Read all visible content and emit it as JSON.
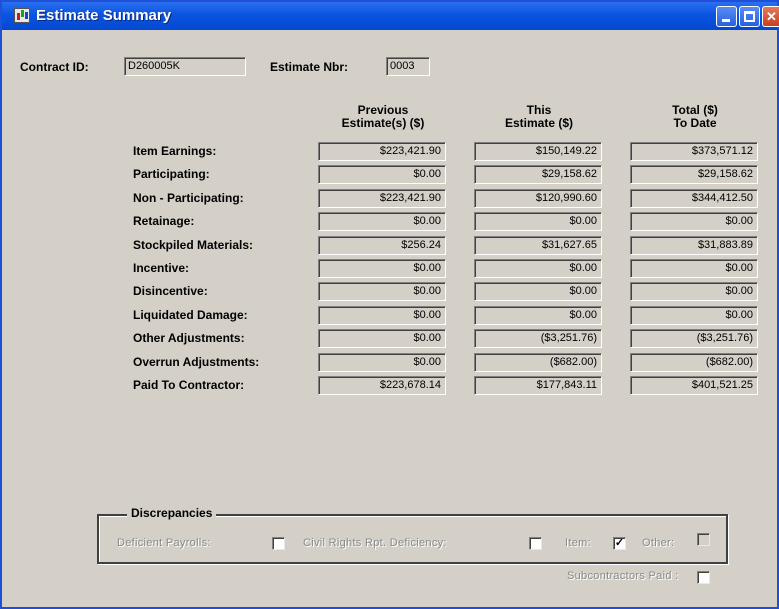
{
  "window": {
    "title": "Estimate Summary"
  },
  "header": {
    "contract_label": "Contract ID:",
    "contract_value": "D260005K",
    "estimate_label": "Estimate Nbr:",
    "estimate_value": "0003"
  },
  "columns": {
    "previous": {
      "line1": "Previous",
      "line2": "Estimate(s) ($)"
    },
    "this": {
      "line1": "This",
      "line2": "Estimate ($)"
    },
    "total": {
      "line1": "Total ($)",
      "line2": "To Date"
    }
  },
  "rows": [
    {
      "label": "Item Earnings:",
      "previous": "$223,421.90",
      "this": "$150,149.22",
      "total": "$373,571.12"
    },
    {
      "label": "Participating:",
      "previous": "$0.00",
      "this": "$29,158.62",
      "total": "$29,158.62"
    },
    {
      "label": "Non - Participating:",
      "previous": "$223,421.90",
      "this": "$120,990.60",
      "total": "$344,412.50"
    },
    {
      "label": "Retainage:",
      "previous": "$0.00",
      "this": "$0.00",
      "total": "$0.00"
    },
    {
      "label": "Stockpiled Materials:",
      "previous": "$256.24",
      "this": "$31,627.65",
      "total": "$31,883.89"
    },
    {
      "label": "Incentive:",
      "previous": "$0.00",
      "this": "$0.00",
      "total": "$0.00"
    },
    {
      "label": "Disincentive:",
      "previous": "$0.00",
      "this": "$0.00",
      "total": "$0.00"
    },
    {
      "label": "Liquidated Damage:",
      "previous": "$0.00",
      "this": "$0.00",
      "total": "$0.00"
    },
    {
      "label": "Other Adjustments:",
      "previous": "$0.00",
      "this": "($3,251.76)",
      "total": "($3,251.76)"
    },
    {
      "label": "Overrun Adjustments:",
      "previous": "$0.00",
      "this": "($682.00)",
      "total": "($682.00)"
    },
    {
      "label": "Paid To Contractor:",
      "previous": "$223,678.14",
      "this": "$177,843.11",
      "total": "$401,521.25"
    }
  ],
  "discrepancies": {
    "title": "Discrepancies",
    "deficient_payrolls": {
      "label": "Deficient Payrolls:",
      "checked": false
    },
    "civil_rights": {
      "label": "Civil Rights Rpt. Deficiency:",
      "checked": false
    },
    "item": {
      "label": "Item:",
      "checked": true
    },
    "other": {
      "label": "Other:",
      "checked": false
    },
    "subcontractors_paid": {
      "label": "Subcontractors Paid :",
      "checked": false
    }
  }
}
